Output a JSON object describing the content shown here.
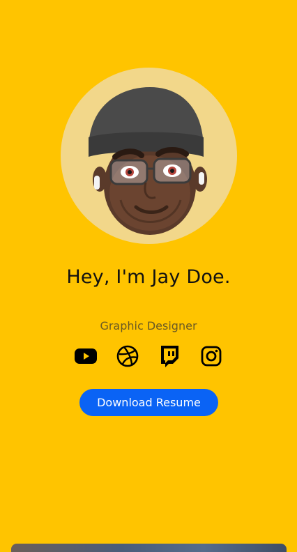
{
  "profile": {
    "greeting": "Hey, I'm Jay Doe.",
    "role": "Graphic Designer"
  },
  "socials": [
    {
      "name": "youtube-icon"
    },
    {
      "name": "dribbble-icon"
    },
    {
      "name": "twitch-icon"
    },
    {
      "name": "instagram-icon"
    }
  ],
  "cta": {
    "download_label": "Download Resume"
  },
  "colors": {
    "background": "#FFC400",
    "avatar_circle": "#F2D78A",
    "button": "#0A63F5"
  }
}
